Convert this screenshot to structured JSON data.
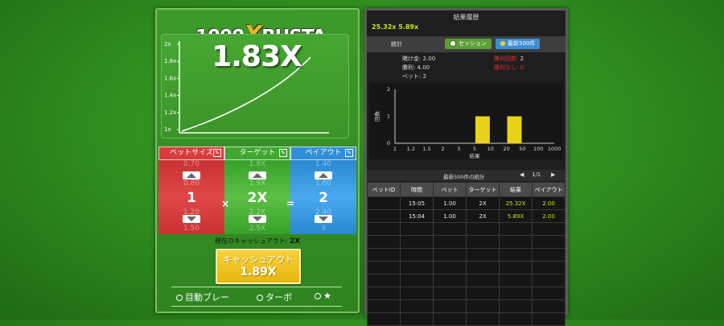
{
  "game": {
    "logo_left": "1000",
    "logo_x": "X",
    "logo_right": "BUSTA",
    "current_multiplier": "1.83X",
    "graph_ticks": [
      "2x",
      "1.8x",
      "1.6x",
      "1.4x",
      "1.2x",
      "1x"
    ]
  },
  "controls": {
    "bet": {
      "label": "ベットサイズ",
      "value": "1",
      "above": "0.70",
      "above2": "0.80",
      "below": "1.20",
      "below2": "1.50"
    },
    "target": {
      "label": "ターゲット",
      "value": "2X",
      "above": "1.8X",
      "above2": "1.9X",
      "below": "2.2X",
      "below2": "2.5X"
    },
    "payout": {
      "label": "ペイアウト",
      "value": "2",
      "above": "1.40",
      "above2": "1.80",
      "below": "2.40",
      "below2": "3"
    },
    "times": "×",
    "equals": "="
  },
  "cashout": {
    "current_label": "現在のキャッシュアウト:",
    "current_value": "2X",
    "button_label": "キャッシュアウト",
    "button_value": "1.89X"
  },
  "options": {
    "auto_play": "目動ブレー",
    "turbo": "ターボ",
    "favorite": "★"
  },
  "results": {
    "title": "結果履歴",
    "recent": "25.32x  5.89x",
    "stats_tab": "統計",
    "session_tab": "セッション",
    "latest500_tab": "最新500件",
    "bet_total_label": "賭け金:",
    "bet_total_value": "2.00",
    "wins_label": "勝利:",
    "wins_value": "4.00",
    "bets_label": "ベット:",
    "bets_value": "2",
    "win_count_label": "勝利回数:",
    "win_count_value": "2",
    "loss_count_label": "勝利なし:",
    "loss_count_value": "0",
    "nav_title": "最新500件の統計",
    "page": "1/1",
    "prev": "◀",
    "next": "▶",
    "columns": [
      "ベットID",
      "時間",
      "ベット",
      "ターゲット",
      "結果",
      "ペイアウト"
    ],
    "rows": [
      [
        "",
        "15:05",
        "1.00",
        "2X",
        "25.32X",
        "2.00"
      ],
      [
        "",
        "15:04",
        "1.00",
        "2X",
        "5.89X",
        "2.00"
      ]
    ]
  },
  "chart_data": {
    "type": "bar",
    "xlabel": "結果",
    "ylabel": "回数",
    "categories": [
      "1",
      "1.2",
      "1.5",
      "2",
      "3",
      "5",
      "10",
      "20",
      "50",
      "100",
      "1000"
    ],
    "series": [
      {
        "values": [
          0,
          0,
          0,
          0,
          0,
          0,
          1,
          0,
          1,
          0,
          0
        ]
      }
    ],
    "ylim": [
      0,
      2
    ],
    "yticks": [
      "0",
      "1",
      "2"
    ],
    "colors": {
      "bar": "#e8d21a"
    }
  }
}
